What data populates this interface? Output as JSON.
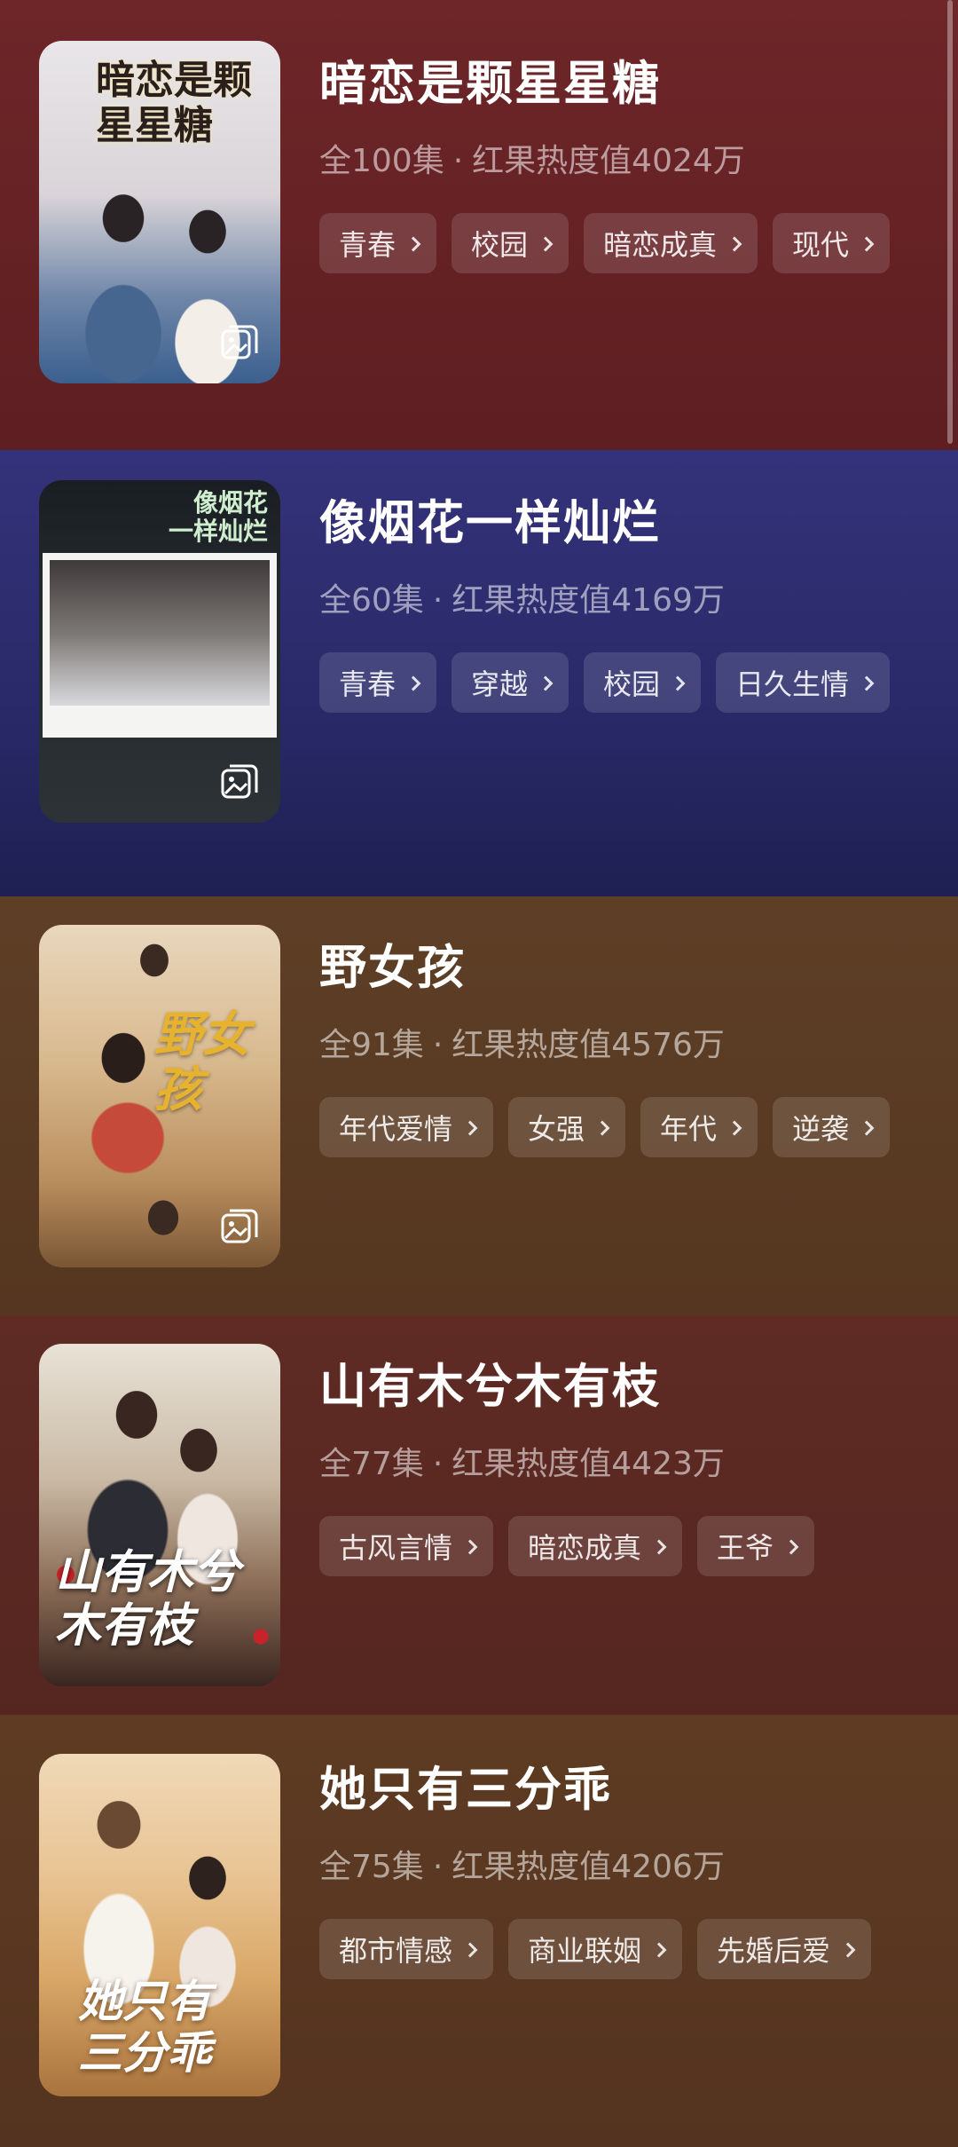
{
  "dramas": [
    {
      "title": "暗恋是颗星星糖",
      "episodes": "全100集",
      "heat": "红果热度值4024万",
      "tags": [
        "青春",
        "校园",
        "暗恋成真",
        "现代"
      ],
      "poster_text": "暗恋是颗\n星星糖",
      "bg_color": "#6b2426"
    },
    {
      "title": "像烟花一样灿烂",
      "episodes": "全60集",
      "heat": "红果热度值4169万",
      "tags": [
        "青春",
        "穿越",
        "校园",
        "日久生情"
      ],
      "poster_text": "像烟花\n一样灿烂",
      "bg_color": "#2b2a6b"
    },
    {
      "title": "野女孩",
      "episodes": "全91集",
      "heat": "红果热度值4576万",
      "tags": [
        "年代爱情",
        "女强",
        "年代",
        "逆袭"
      ],
      "poster_text": "野女孩",
      "bg_color": "#5a3a22"
    },
    {
      "title": "山有木兮木有枝",
      "episodes": "全77集",
      "heat": "红果热度值4423万",
      "tags": [
        "古风言情",
        "暗恋成真",
        "王爷"
      ],
      "poster_text": "山有木兮\n木有枝",
      "bg_color": "#5e2a24"
    },
    {
      "title": "她只有三分乖",
      "episodes": "全75集",
      "heat": "红果热度值4206万",
      "tags": [
        "都市情感",
        "商业联姻",
        "先婚后爱"
      ],
      "poster_text": "她只有\n三分乖",
      "bg_color": "#5a3a20"
    }
  ],
  "separator": "·",
  "icons": {
    "gallery": "gallery-icon",
    "chevron": "chevron-right-icon"
  }
}
